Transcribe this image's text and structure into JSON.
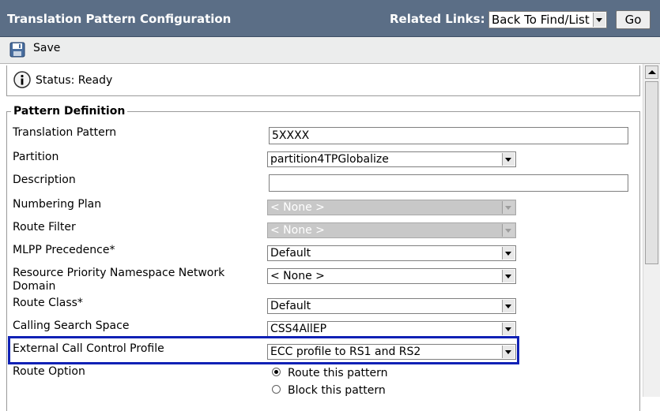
{
  "header": {
    "title": "Translation Pattern Configuration",
    "related_links_label": "Related Links:",
    "related_links_value": "Back To Find/List",
    "go_label": "Go"
  },
  "toolbar": {
    "save_label": "Save",
    "save_icon": "floppy-disk-icon"
  },
  "status": {
    "text": "Status: Ready",
    "icon": "info-icon"
  },
  "pattern_definition": {
    "legend": "Pattern Definition",
    "translation_pattern": {
      "label": "Translation Pattern",
      "value": "5XXXX"
    },
    "partition": {
      "label": "Partition",
      "value": "partition4TPGlobalize"
    },
    "description": {
      "label": "Description",
      "value": ""
    },
    "numbering_plan": {
      "label": "Numbering Plan",
      "value": "< None >",
      "disabled": true
    },
    "route_filter": {
      "label": "Route Filter",
      "value": "< None >",
      "disabled": true
    },
    "mlpp_precedence": {
      "label": "MLPP Precedence*",
      "value": "Default"
    },
    "resource_priority": {
      "label_line1": "Resource Priority Namespace Network",
      "label_line2": "Domain",
      "value": "< None >"
    },
    "route_class": {
      "label": "Route Class*",
      "value": "Default"
    },
    "calling_search_space": {
      "label": "Calling Search Space",
      "value": "CSS4AllEP"
    },
    "ecc_profile": {
      "label": "External Call Control Profile",
      "value": "ECC profile to RS1 and RS2"
    },
    "route_option": {
      "label": "Route Option",
      "options": [
        {
          "label": "Route this pattern",
          "checked": true
        },
        {
          "label": "Block this pattern",
          "checked": false
        }
      ]
    }
  },
  "colors": {
    "title_bar": "#5b6e86",
    "highlight_border": "#1021b5"
  }
}
